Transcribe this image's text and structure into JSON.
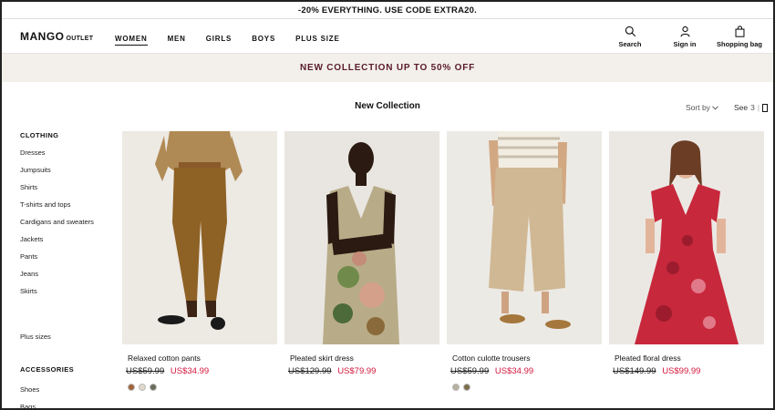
{
  "promo_top": "-20% EVERYTHING. USE CODE EXTRA20.",
  "header": {
    "logo_main": "MANGO",
    "logo_sub": "OUTLET",
    "nav": [
      "WOMEN",
      "MEN",
      "GIRLS",
      "BOYS",
      "PLUS SIZE"
    ],
    "active_nav": "WOMEN",
    "search_label": "Search",
    "signin_label": "Sign in",
    "bag_label": "Shopping bag"
  },
  "banner": "NEW COLLECTION UP TO 50% OFF",
  "section_title": "New Collection",
  "sort_by": "Sort by",
  "see": {
    "label": "See",
    "value": "3"
  },
  "sidebar": {
    "clothing_head": "CLOTHING",
    "clothing_items": [
      "Dresses",
      "Jumpsuits",
      "Shirts",
      "T-shirts and tops",
      "Cardigans and sweaters",
      "Jackets",
      "Pants",
      "Jeans",
      "Skirts"
    ],
    "plus_sizes": "Plus sizes",
    "accessories_head": "ACCESSORIES",
    "accessories_items": [
      "Shoes",
      "Bags"
    ]
  },
  "products": [
    {
      "name": "Relaxed cotton pants",
      "old_price": "US$59.99",
      "new_price": "US$34.99",
      "swatches": [
        "#a0623a",
        "#e0d8cc",
        "#6b6b5c"
      ]
    },
    {
      "name": "Pleated skirt dress",
      "old_price": "US$129.99",
      "new_price": "US$79.99",
      "swatches": []
    },
    {
      "name": "Cotton culotte trousers",
      "old_price": "US$59.99",
      "new_price": "US$34.99",
      "swatches": [
        "#b8b09e",
        "#7a6e4a"
      ]
    },
    {
      "name": "Pleated floral dress",
      "old_price": "US$149.99",
      "new_price": "US$99.99",
      "swatches": []
    }
  ],
  "colors": {
    "sale_red": "#d3163c",
    "banner_bg": "#f3f0eb",
    "banner_text": "#5a1a2a",
    "photo_bg": "#ebe7e1"
  }
}
